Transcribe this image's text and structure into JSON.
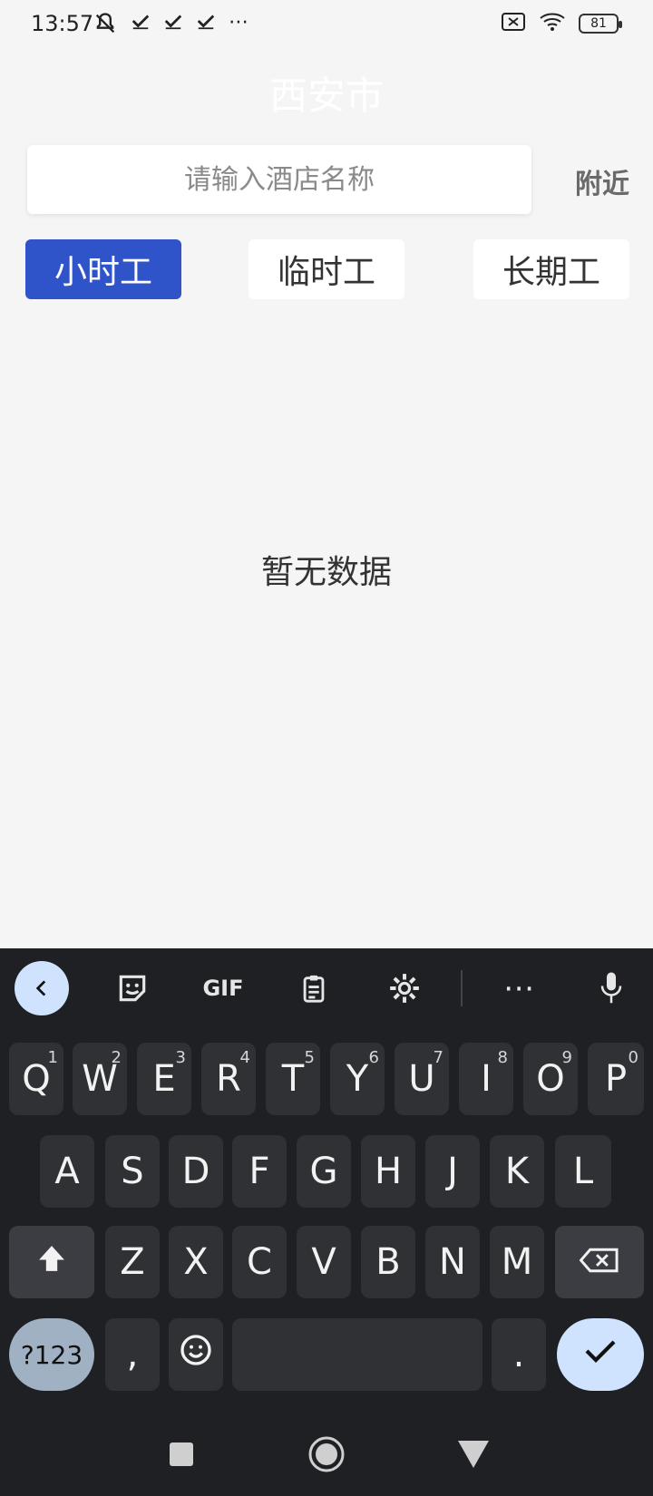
{
  "status": {
    "time": "13:57",
    "left_icons": [
      "mute-bell-icon",
      "check-icon",
      "check-icon",
      "check-icon",
      "more-icon"
    ],
    "battery": "81"
  },
  "header": {
    "city": "西安市"
  },
  "search": {
    "placeholder": "请输入酒店名称",
    "nearby_label": "附近"
  },
  "tabs": [
    {
      "label": "小时工",
      "active": true
    },
    {
      "label": "临时工",
      "active": false
    },
    {
      "label": "长期工",
      "active": false
    }
  ],
  "content": {
    "empty_text": "暂无数据"
  },
  "keyboard": {
    "toolbar": {
      "gif_label": "GIF"
    },
    "row1": [
      {
        "k": "Q",
        "n": "1"
      },
      {
        "k": "W",
        "n": "2"
      },
      {
        "k": "E",
        "n": "3"
      },
      {
        "k": "R",
        "n": "4"
      },
      {
        "k": "T",
        "n": "5"
      },
      {
        "k": "Y",
        "n": "6"
      },
      {
        "k": "U",
        "n": "7"
      },
      {
        "k": "I",
        "n": "8"
      },
      {
        "k": "O",
        "n": "9"
      },
      {
        "k": "P",
        "n": "0"
      }
    ],
    "row2": [
      "A",
      "S",
      "D",
      "F",
      "G",
      "H",
      "J",
      "K",
      "L"
    ],
    "row3": [
      "Z",
      "X",
      "C",
      "V",
      "B",
      "N",
      "M"
    ],
    "symbols_label": "?123",
    "comma_label": ",",
    "period_label": "."
  }
}
